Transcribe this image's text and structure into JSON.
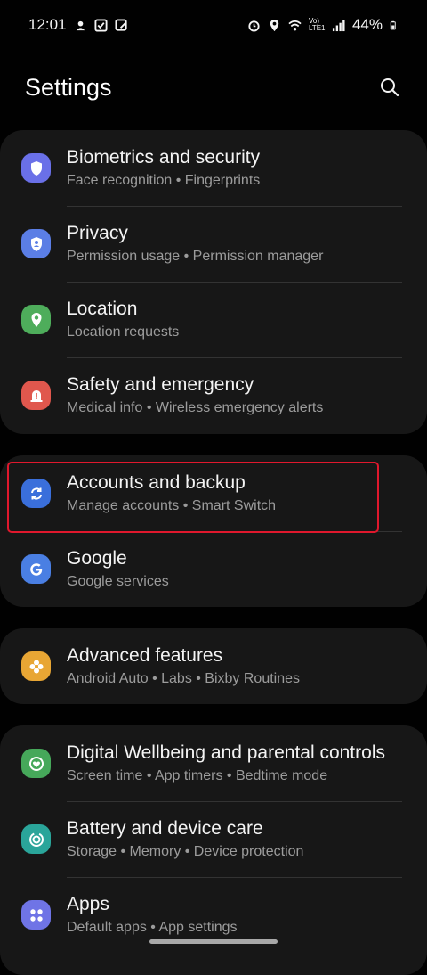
{
  "status": {
    "time": "12:01",
    "battery": "44%",
    "network_label": "Vo) LTE1"
  },
  "header": {
    "title": "Settings"
  },
  "groups": [
    {
      "items": [
        {
          "title": "Biometrics and security",
          "subtitle": "Face recognition  •  Fingerprints",
          "icon": "shield-icon",
          "color": "#6a70e8"
        },
        {
          "title": "Privacy",
          "subtitle": "Permission usage  •  Permission manager",
          "icon": "privacy-shield-icon",
          "color": "#5b7ee5"
        },
        {
          "title": "Location",
          "subtitle": "Location requests",
          "icon": "location-pin-icon",
          "color": "#4ead5b"
        },
        {
          "title": "Safety and emergency",
          "subtitle": "Medical info  •  Wireless emergency alerts",
          "icon": "siren-icon",
          "color": "#e0574d"
        }
      ]
    },
    {
      "items": [
        {
          "title": "Accounts and backup",
          "subtitle": "Manage accounts  •  Smart Switch",
          "icon": "sync-icon",
          "color": "#3a6fdb"
        },
        {
          "title": "Google",
          "subtitle": "Google services",
          "icon": "google-g-icon",
          "color": "#4a7fe3"
        }
      ]
    },
    {
      "items": [
        {
          "title": "Advanced features",
          "subtitle": "Android Auto  •  Labs  •  Bixby Routines",
          "icon": "flower-gear-icon",
          "color": "#e8a634"
        }
      ]
    },
    {
      "items": [
        {
          "title": "Digital Wellbeing and parental controls",
          "subtitle": "Screen time  •  App timers  •  Bedtime mode",
          "icon": "wellbeing-heart-icon",
          "color": "#46a85a"
        },
        {
          "title": "Battery and device care",
          "subtitle": "Storage  •  Memory  •  Device protection",
          "icon": "device-care-icon",
          "color": "#2aa59a"
        },
        {
          "title": "Apps",
          "subtitle": "Default apps  •  App settings",
          "icon": "apps-grid-icon",
          "color": "#6f74e6"
        }
      ]
    }
  ],
  "colors": {
    "highlight": "#e0182d",
    "background": "#010101",
    "card": "#171717"
  }
}
